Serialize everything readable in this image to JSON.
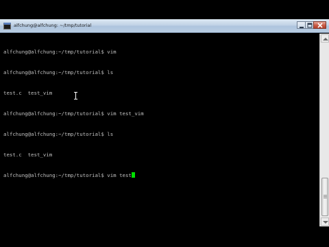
{
  "window": {
    "title": "alfchung@alfchung: ~/tmp/tutorial",
    "icon": "terminal-icon",
    "controls": [
      "minimize",
      "maximize",
      "close"
    ]
  },
  "terminal": {
    "lines": [
      "alfchung@alfchung:~/tmp/tutorial$ vim",
      "alfchung@alfchung:~/tmp/tutorial$ ls",
      "test.c  test_vim",
      "alfchung@alfchung:~/tmp/tutorial$ vim test_vim",
      "alfchung@alfchung:~/tmp/tutorial$ ls",
      "test.c  test_vim",
      "alfchung@alfchung:~/tmp/tutorial$ vim test"
    ],
    "cursor_color": "#00e000",
    "text_color": "#c0c0c0",
    "background": "#000000"
  }
}
